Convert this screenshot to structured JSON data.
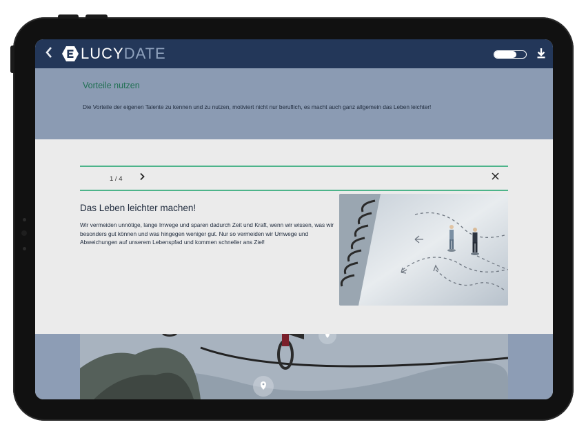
{
  "app": {
    "back_label": "<",
    "logo_part1": "LUCY",
    "logo_part2": "DATE"
  },
  "info": {
    "title": "Vorteile nutzen",
    "text": "Die Vorteile der eigenen Talente zu kennen und zu nutzen, motiviert nicht nur beruflich, es macht auch ganz allgemein das Leben leichter!"
  },
  "pager": {
    "current": "1 / 4",
    "next_label": "›",
    "close_label": "✕"
  },
  "article": {
    "title": "Das Leben leichter machen!",
    "text": "Wir vermeiden unnötige, lange Irrwege und sparen dadurch Zeit und Kraft, wenn wir wissen, was wir besonders gut können und was hingegen weniger gut. Nur so vermeiden wir Umwege und Abweichungen auf unserem Lebenspfad und kommen schneller ans Ziel!"
  },
  "colors": {
    "topbar": "#233759",
    "info_bg": "#8b9bb3",
    "accent_green": "#4db48a",
    "title_green": "#1f6f52"
  },
  "icons": {
    "back": "chevron-left-icon",
    "logo": "lucydate-logo-icon",
    "toggle": "toggle-switch-icon",
    "download": "download-icon",
    "next": "chevron-right-icon",
    "close": "close-icon",
    "pin": "map-pin-icon"
  }
}
